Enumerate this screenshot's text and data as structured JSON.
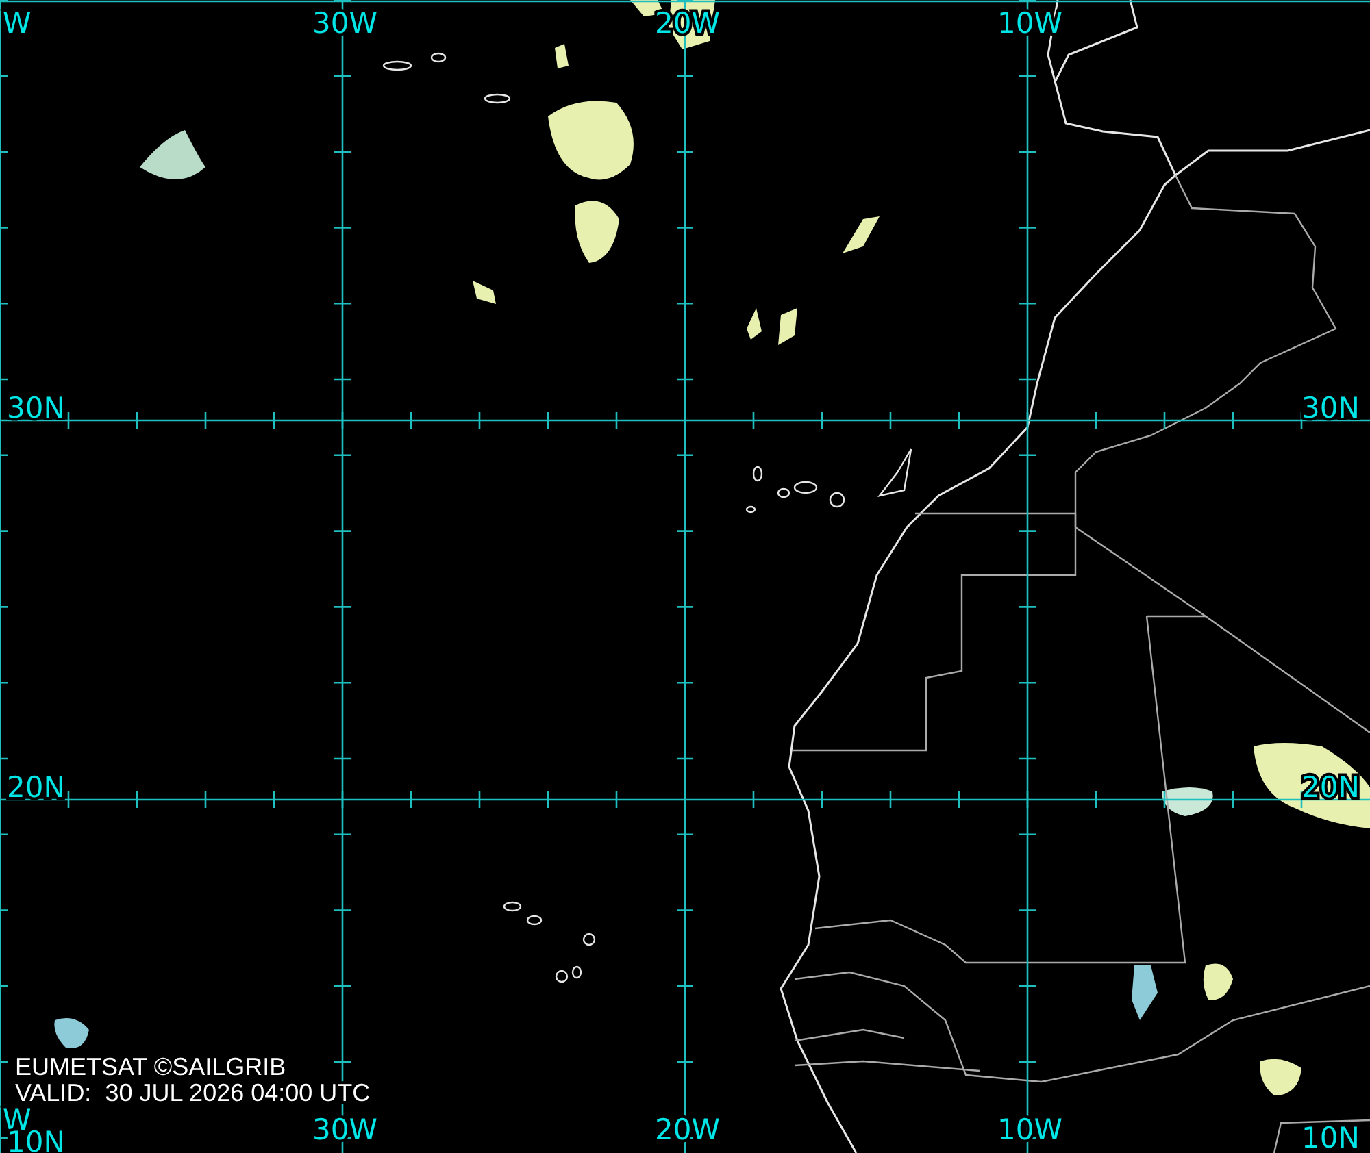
{
  "map": {
    "grid_labels": {
      "top": [
        "W",
        "30W",
        "20W",
        "10W"
      ],
      "left": [
        "30N",
        "20N",
        "10N"
      ],
      "right": [
        "30N",
        "20N",
        "10N"
      ],
      "bottom": [
        "W",
        "30W",
        "20W",
        "10W"
      ]
    }
  },
  "credit": {
    "source": "EUMETSAT ©SAILGRIB",
    "valid": "VALID:  30 JUL 2026 04:00 UTC"
  }
}
